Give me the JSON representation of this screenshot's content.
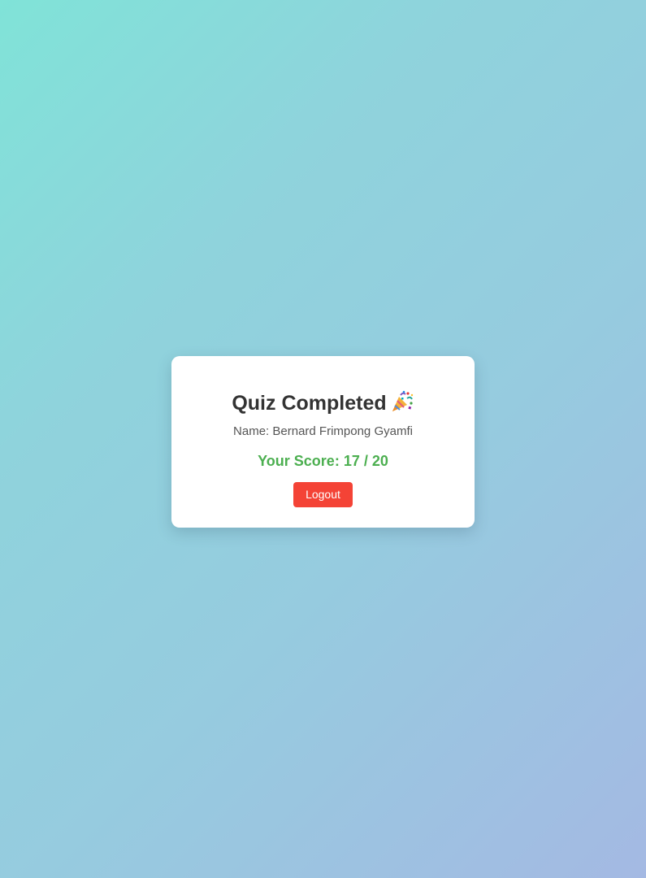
{
  "result_card": {
    "title": "Quiz Completed",
    "title_icon": "party-popper-icon",
    "name_label": "Name:",
    "name_value": "Bernard Frimpong Gyamfi",
    "score_label": "Your Score:",
    "score_value": "17 / 20",
    "score_color": "#4caf50",
    "logout_label": "Logout",
    "logout_color": "#f44336"
  }
}
